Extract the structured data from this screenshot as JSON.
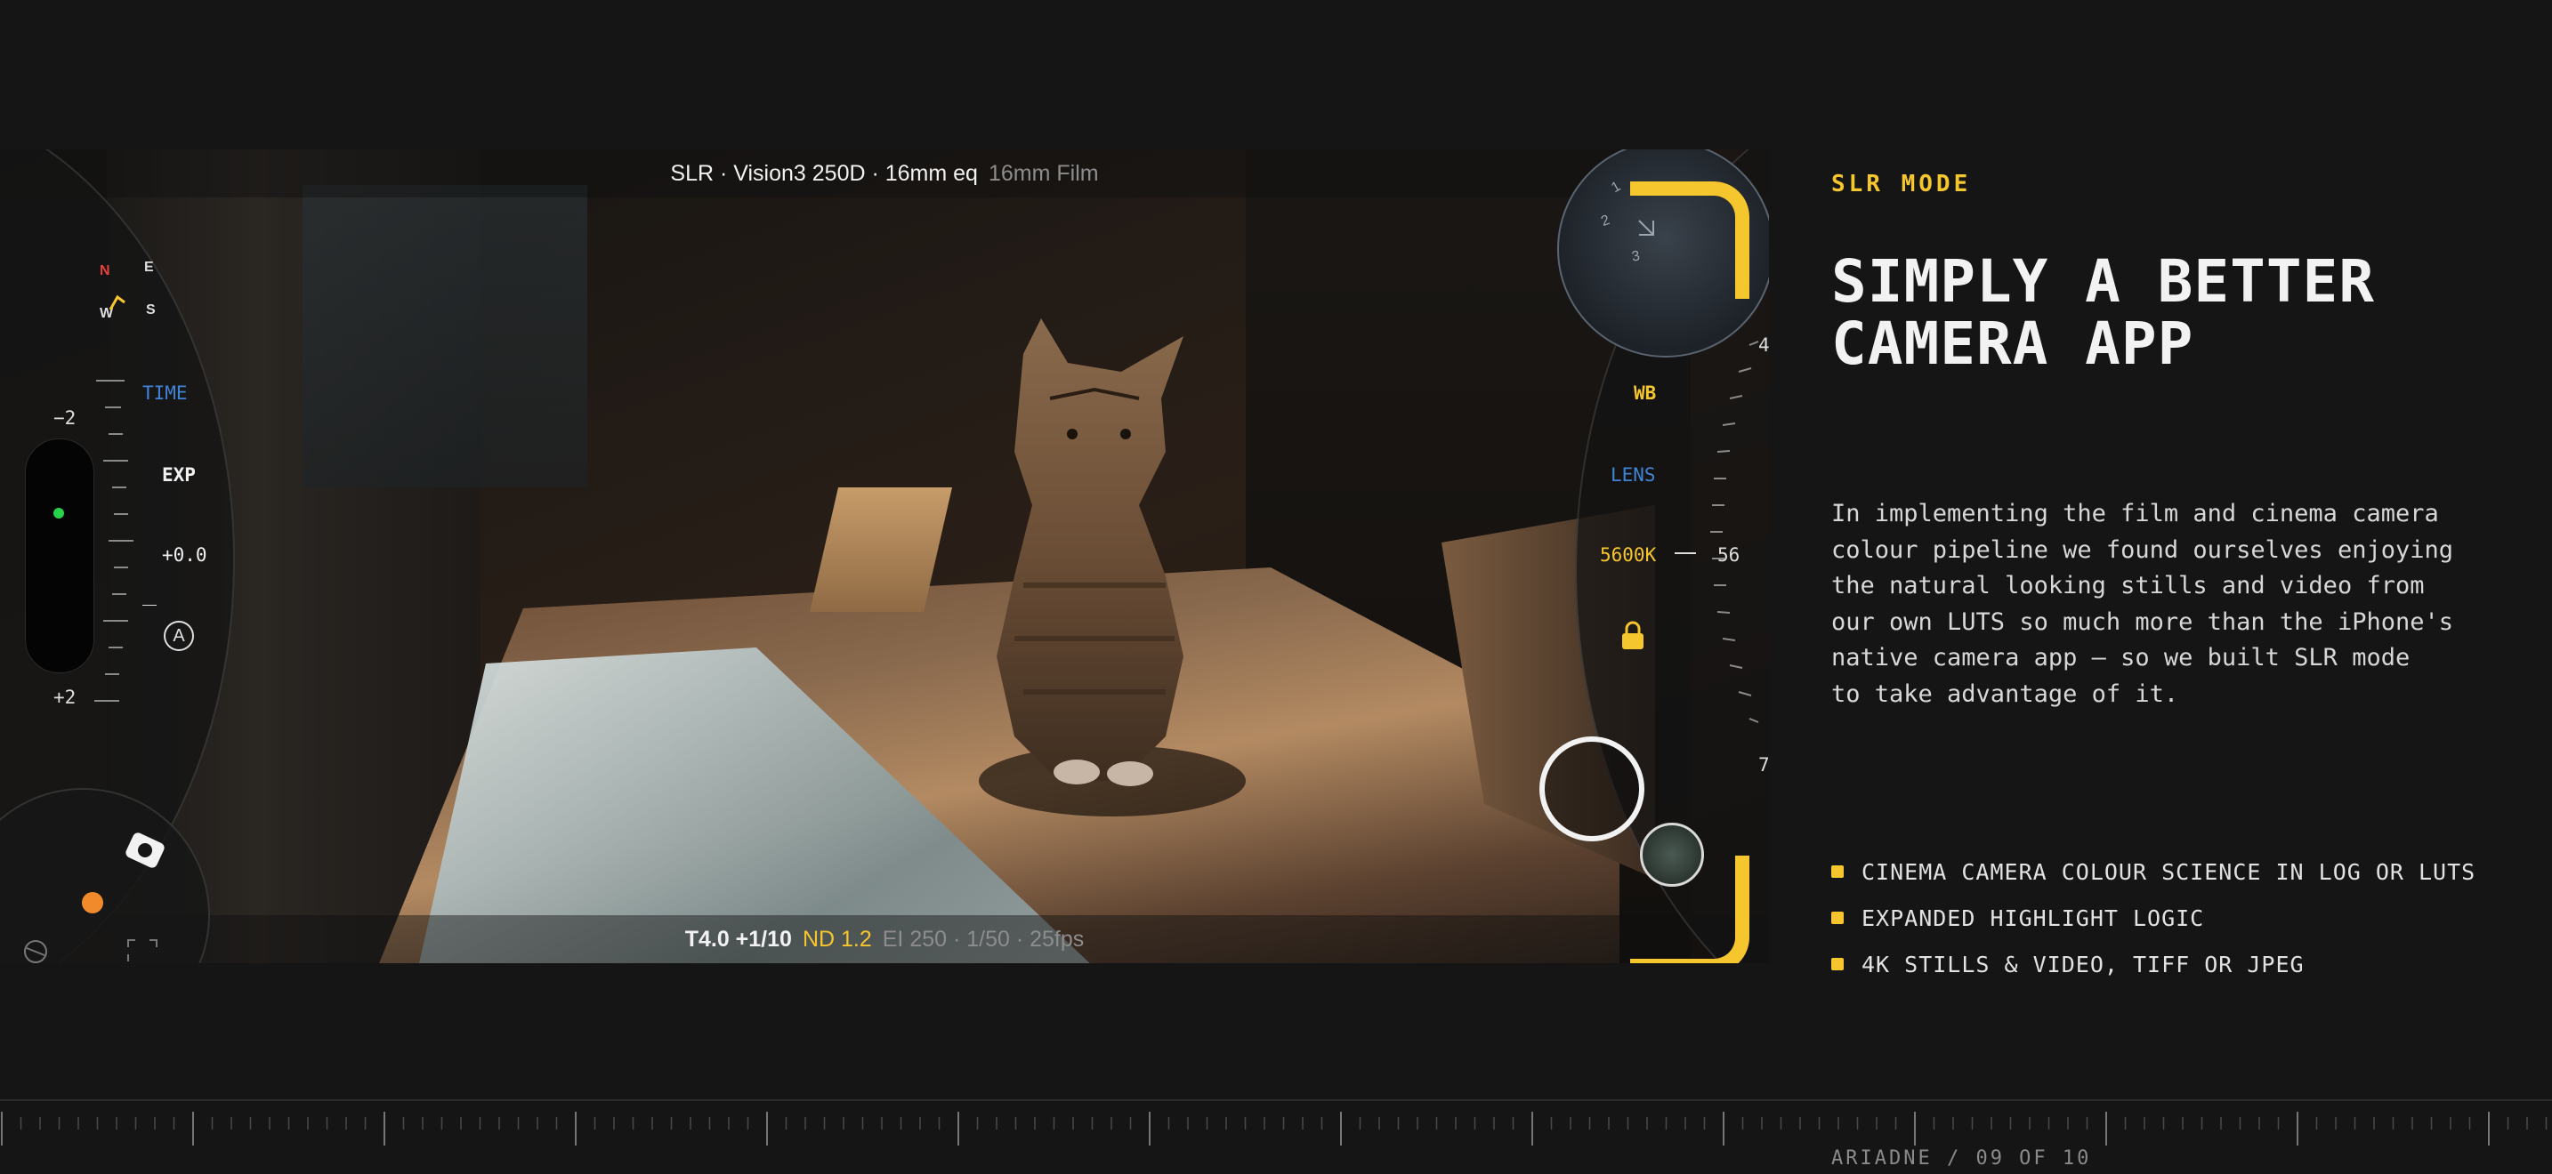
{
  "camera": {
    "top_info": {
      "main": "SLR · Vision3 250D · 16mm eq",
      "secondary": "16mm Film"
    },
    "bottom_info": {
      "exposure": "T4.0 +1/10",
      "nd": "ND 1.2",
      "rest": "EI 250 · 1/50 · 25fps"
    },
    "left_dial": {
      "compass": {
        "n": "N",
        "e": "E",
        "w": "W",
        "s": "S"
      },
      "time_label": "TIME",
      "exp_label": "EXP",
      "exp_value": "+0.0",
      "scale_top": "−2",
      "scale_bottom": "+2",
      "auto_label": "A"
    },
    "right_dial": {
      "wb_label": "WB",
      "lens_label": "LENS",
      "wb_value": "5600K",
      "scale_top": "4",
      "scale_mid": "56",
      "scale_bottom": "7",
      "lens_numbers": [
        "1",
        "2",
        "3"
      ]
    },
    "colors": {
      "accent": "#f6c62e",
      "time": "#3f84d6",
      "lens": "#3f84d6",
      "north": "#e8413a",
      "exp_indicator": "#27d34b",
      "record_dot": "#f08a2a"
    }
  },
  "content": {
    "mode_label": "SLR MODE",
    "headline": "SIMPLY A BETTER\nCAMERA APP",
    "body": "In implementing the film and cinema camera\ncolour pipeline we found ourselves enjoying\nthe natural looking stills and video from\nour own LUTS so much more than the iPhone's\nnative camera app — so we built SLR mode\nto take advantage of it.",
    "features": [
      "CINEMA CAMERA COLOUR SCIENCE IN LOG OR LUTS",
      "EXPANDED HIGHLIGHT LOGIC",
      "4K STILLS & VIDEO, TIFF OR JPEG"
    ]
  },
  "footer": {
    "pager": "ARIADNE / 09 OF 10"
  }
}
